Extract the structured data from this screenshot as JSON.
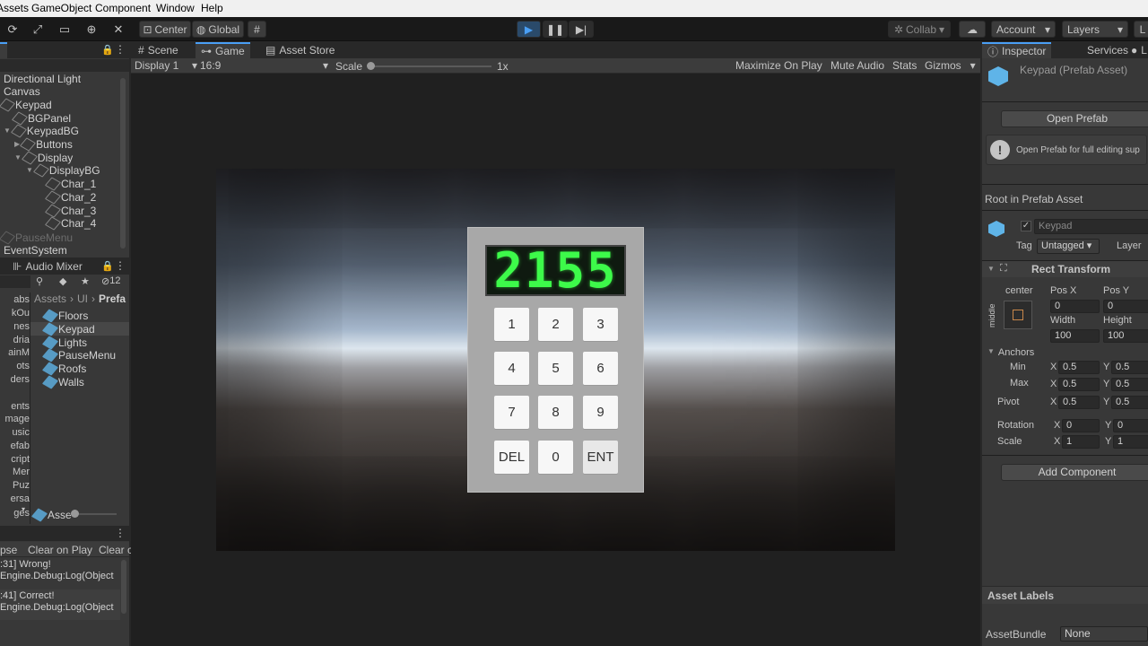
{
  "menubar": {
    "items": [
      "Assets",
      "GameObject",
      "Component",
      "Window",
      "Help"
    ]
  },
  "toolbar": {
    "center_label": "Center",
    "global_label": "Global",
    "collab_label": "Collab",
    "account_label": "Account",
    "layers_label": "Layers",
    "layout_label": "L"
  },
  "hierarchy": {
    "items": [
      {
        "label": "Directional Light"
      },
      {
        "label": "Canvas"
      },
      {
        "label": "Keypad"
      },
      {
        "label": "BGPanel"
      },
      {
        "label": "KeypadBG"
      },
      {
        "label": "Buttons"
      },
      {
        "label": "Display"
      },
      {
        "label": "DisplayBG"
      },
      {
        "label": "Char_1"
      },
      {
        "label": "Char_2"
      },
      {
        "label": "Char_3"
      },
      {
        "label": "Char_4"
      },
      {
        "label": "PauseMenu"
      },
      {
        "label": "EventSystem"
      }
    ]
  },
  "project": {
    "tab_label": "Audio Mixer",
    "breadcrumb": [
      "Assets",
      "UI",
      "Prefa"
    ],
    "hidden_count": "12",
    "left_items": [
      "abs",
      "kOu",
      "nes",
      "dria",
      "ainM",
      "ots",
      "ders",
      "ents",
      "mage",
      "usic",
      "efab",
      "cript",
      "Mer",
      "Puz",
      "ersa",
      "ges"
    ],
    "files": [
      {
        "label": "Floors"
      },
      {
        "label": "Keypad"
      },
      {
        "label": "Lights"
      },
      {
        "label": "PauseMenu"
      },
      {
        "label": "Roofs"
      },
      {
        "label": "Walls"
      }
    ],
    "footer_label": "Asse"
  },
  "console": {
    "btn_collapse": "pse",
    "btn_clear_on_play": "Clear on Play",
    "btn_clear": "Clear c",
    "rows": [
      {
        "line1": ":31] Wrong!",
        "line2": "Engine.Debug:Log(Object"
      },
      {
        "line1": ":41] Correct!",
        "line2": "Engine.Debug:Log(Object"
      }
    ]
  },
  "scene_tabs": {
    "scene": "Scene",
    "game": "Game",
    "asset_store": "Asset Store"
  },
  "game_toolbar": {
    "display": "Display 1",
    "aspect": "16:9",
    "scale_label": "Scale",
    "scale_value": "1x",
    "maximize": "Maximize On Play",
    "mute": "Mute Audio",
    "stats": "Stats",
    "gizmos": "Gizmos"
  },
  "game": {
    "display_chars": "2155",
    "keys": [
      "1",
      "2",
      "3",
      "4",
      "5",
      "6",
      "7",
      "8",
      "9",
      "DEL",
      "0",
      "ENT"
    ]
  },
  "inspector": {
    "tab_inspector": "Inspector",
    "tab_services": "Services",
    "tab_more": "L",
    "title": "Keypad (Prefab Asset)",
    "open_prefab": "Open Prefab",
    "info_text": "Open Prefab for full editing sup",
    "root_label": "Root in Prefab Asset",
    "object_name": "Keypad",
    "tag_label": "Tag",
    "tag_value": "Untagged",
    "layer_label": "Layer",
    "rect_transform": "Rect Transform",
    "anchor_h": "center",
    "anchor_v": "middle",
    "pos_x_label": "Pos X",
    "pos_y_label": "Pos Y",
    "pos_x": "0",
    "pos_y": "0",
    "width_label": "Width",
    "height_label": "Height",
    "width": "100",
    "height": "100",
    "anchors_label": "Anchors",
    "min_label": "Min",
    "max_label": "Max",
    "pivot_label": "Pivot",
    "rotation_label": "Rotation",
    "scale_label": "Scale",
    "x_label": "X",
    "y_label": "Y",
    "min_x": "0.5",
    "min_y": "0.5",
    "max_x": "0.5",
    "max_y": "0.5",
    "pivot_x": "0.5",
    "pivot_y": "0.5",
    "rot_x": "0",
    "rot_y": "0",
    "scale_x": "1",
    "scale_y": "1",
    "add_component": "Add Component",
    "asset_labels": "Asset Labels",
    "assetbundle_label": "AssetBundle",
    "assetbundle_value": "None"
  },
  "colors": {
    "accent": "#4a9ff5",
    "lcd_green": "#3dfa4a",
    "panel_bg": "#383838",
    "prefab_blue": "#5fb4e8"
  }
}
